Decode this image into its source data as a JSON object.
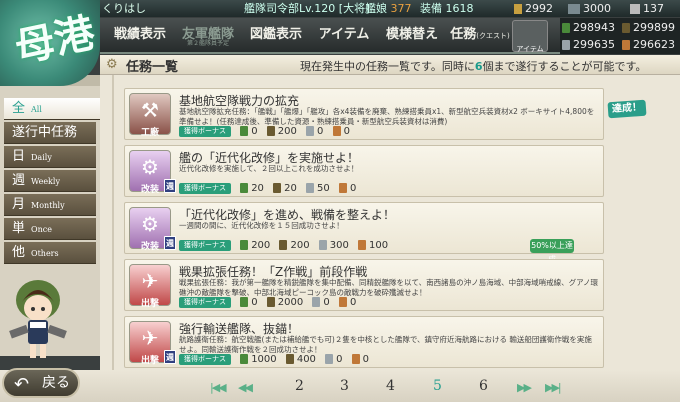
{
  "topbar": {
    "admiral_name": "くりはし",
    "level_text": "艦隊司令部Lv.120 [大将]",
    "ships_label": "艦娘",
    "ships_count": "377",
    "equip_label": "装備",
    "equip_count": "1618",
    "res1": "2992",
    "res2": "3000",
    "res3": "137"
  },
  "resources": {
    "fuel": "298943",
    "ammo": "299899",
    "steel": "299635",
    "bauxite": "296623"
  },
  "logo": {
    "text": "母港"
  },
  "nav": {
    "items": [
      {
        "label": "戦績表示"
      },
      {
        "label": "友軍艦隊",
        "sub": "第２艦隊員予定"
      },
      {
        "label": "図鑑表示"
      },
      {
        "label": "アイテム"
      },
      {
        "label": "模様替え"
      },
      {
        "label": "任務",
        "small": "(クエスト)"
      }
    ],
    "shop_label": "アイテム屋"
  },
  "title": {
    "heading": "任務一覧",
    "msg_before": "現在発生中の任務一覧です。同時に",
    "msg_num": "6",
    "msg_after": "個まで遂行することが可能です。"
  },
  "sidebar": {
    "items": [
      {
        "jp": "全",
        "en": "All"
      },
      {
        "jp": "遂行中任務",
        "en": ""
      },
      {
        "jp": "日",
        "en": "Daily"
      },
      {
        "jp": "週",
        "en": "Weekly"
      },
      {
        "jp": "月",
        "en": "Monthly"
      },
      {
        "jp": "単",
        "en": "Once"
      },
      {
        "jp": "他",
        "en": "Others"
      }
    ]
  },
  "quests": [
    {
      "category": "工廠",
      "title": "基地航空隊戦力の拡充",
      "desc": "基地航空隊拡充任務：「艦戦」「艦爆」「艦攻」各x4装備を廃棄、熟練搭乗員x1、新型航空兵装資材x2 ボーキサイト4,800を準備せよ！(任務達成後、準備した資源・熟練搭乗員・新型航空兵装資材は消費)",
      "bonus": "獲得ボーナス",
      "rewards": [
        "0",
        "200",
        "0",
        "0"
      ],
      "status": "達成！"
    },
    {
      "category": "改装",
      "title": "艦の「近代化改修」を実施せよ！",
      "desc": "近代化改修を実施して、２回以上これを成功させよ！",
      "bonus": "獲得ボーナス",
      "rewards": [
        "20",
        "20",
        "50",
        "0"
      ],
      "status": ""
    },
    {
      "category": "改装",
      "title": "「近代化改修」を進め、戦備を整えよ！",
      "desc": "一週間の間に、近代化改修を１５回成功させよ！",
      "bonus": "獲得ボーナス",
      "rewards": [
        "200",
        "200",
        "300",
        "100"
      ],
      "status": "50%以上達成"
    },
    {
      "category": "出撃",
      "title": "戦果拡張任務！「Z作戦」前段作戦",
      "desc": "戦果拡張任務：我が第一艦隊を精鋭艦隊を集中配備、同精鋭艦隊を以て、南西諸島の沖ノ島海域、中部海域哨戒線、グアノ環礁沖の敵艦隊を撃破、中部北海域ピーコック島の敵戦力を破砕殲滅せよ！",
      "bonus": "獲得ボーナス",
      "rewards": [
        "0",
        "2000",
        "0",
        "0"
      ],
      "status": ""
    },
    {
      "category": "出撃",
      "title": "強行輸送艦隊、抜錨！",
      "desc": "航路護衛任務：航空戦艦(または補給艦でも可)２隻を中核とした艦隊で、鎮守府近海航路における 輸送船団護衛作戦を実施せよ。同輸送護衛作戦を２回成功させよ！",
      "bonus": "獲得ボーナス",
      "rewards": [
        "1000",
        "400",
        "0",
        "0"
      ],
      "status": ""
    }
  ],
  "back_label": "戻る",
  "pagination": {
    "pages": [
      "2",
      "3",
      "4",
      "5",
      "6"
    ],
    "current": "5"
  },
  "colors": {
    "accent": "#2aa090",
    "nav_bg": "#262b2b",
    "panel": "#ebe6d8"
  }
}
